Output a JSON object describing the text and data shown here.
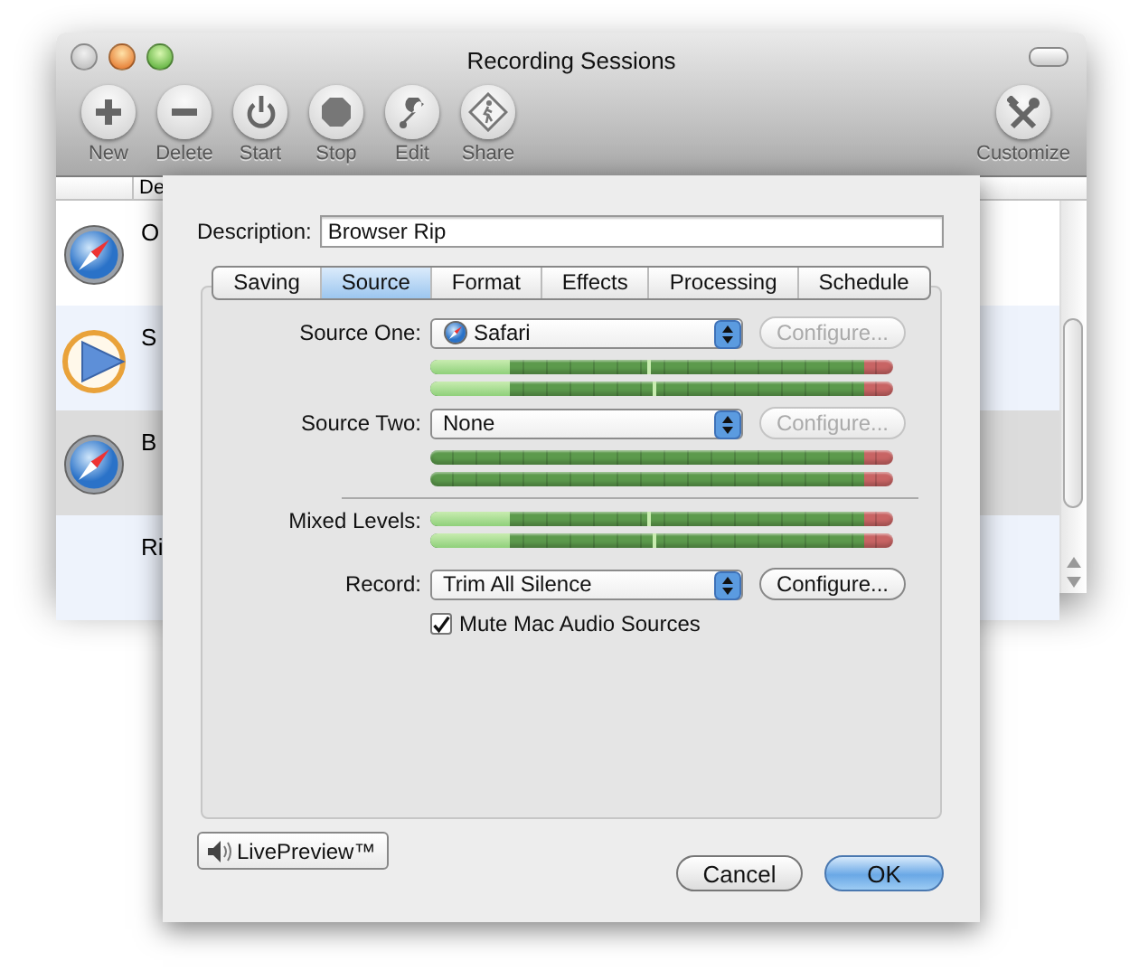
{
  "window": {
    "title": "Recording Sessions"
  },
  "toolbar": [
    {
      "label": "New"
    },
    {
      "label": "Delete"
    },
    {
      "label": "Start"
    },
    {
      "label": "Stop"
    },
    {
      "label": "Edit"
    },
    {
      "label": "Share"
    }
  ],
  "customize": {
    "label": "Customize"
  },
  "table": {
    "columns": [
      "De"
    ],
    "rows": [
      {
        "kind": "compass",
        "cell": "O",
        "selected": false
      },
      {
        "kind": "play",
        "cell": "S",
        "selected": false
      },
      {
        "kind": "compass",
        "cell": "B",
        "selected": true
      },
      {
        "kind": "none",
        "cell": "Ri",
        "selected": false
      }
    ]
  },
  "sheet": {
    "description": {
      "label": "Description:",
      "value": "Browser Rip"
    },
    "tabs": [
      {
        "label": "Saving",
        "selected": false
      },
      {
        "label": "Source",
        "selected": true
      },
      {
        "label": "Format",
        "selected": false
      },
      {
        "label": "Effects",
        "selected": false
      },
      {
        "label": "Processing",
        "selected": false
      },
      {
        "label": "Schedule",
        "selected": false
      }
    ],
    "sources": [
      {
        "label": "Source One:",
        "value": "Safari",
        "kind": "compass",
        "configure": {
          "label": "Configure...",
          "disabled": true
        },
        "meters": [
          {
            "level": 0.17,
            "peak": {
              "level": 0.47
            }
          },
          {
            "level": 0.17,
            "peak": {
              "level": 0.48
            }
          }
        ]
      },
      {
        "label": "Source Two:",
        "value": "None",
        "kind": "none",
        "configure": {
          "label": "Configure...",
          "disabled": true
        },
        "meters": [
          {
            "level": 0
          },
          {
            "level": 0
          }
        ]
      }
    ],
    "mixed": {
      "label": "Mixed Levels:",
      "meters": [
        {
          "level": 0.17,
          "peak": {
            "level": 0.47
          }
        },
        {
          "level": 0.17,
          "peak": {
            "level": 0.48
          }
        }
      ]
    },
    "record": {
      "label": "Record:",
      "value": "Trim All Silence",
      "configure": {
        "label": "Configure...",
        "disabled": false
      }
    },
    "mute": {
      "label": "Mute Mac Audio Sources",
      "checked": true
    },
    "live_preview": {
      "label": "LivePreview™"
    },
    "buttons": [
      {
        "label": "Cancel",
        "default": false
      },
      {
        "label": "OK",
        "default": true
      }
    ]
  }
}
